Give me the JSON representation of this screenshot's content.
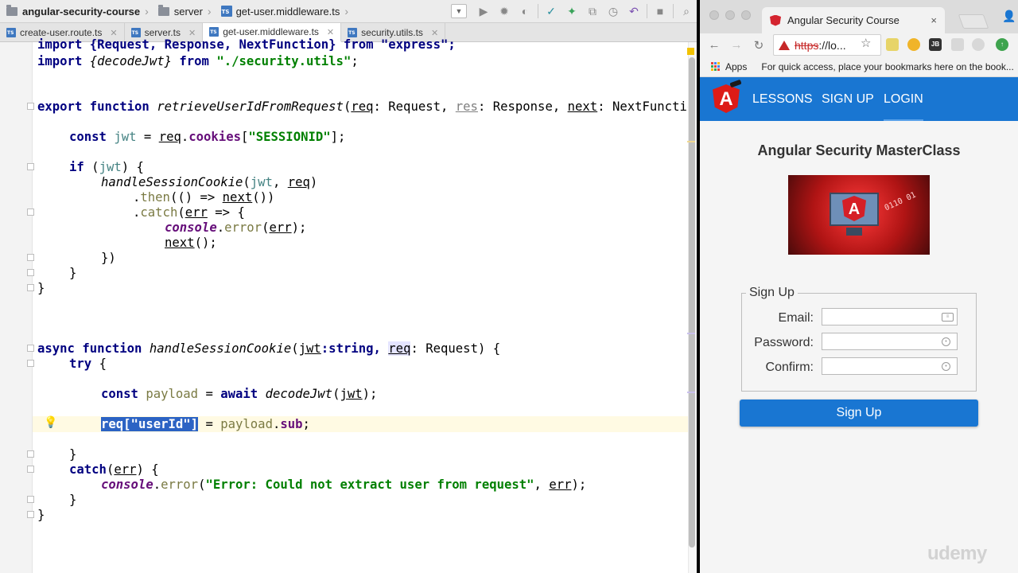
{
  "ide": {
    "breadcrumb": [
      {
        "label": "angular-security-course",
        "icon": "folder-icon"
      },
      {
        "label": "server",
        "icon": "folder-icon"
      },
      {
        "label": "get-user.middleware.ts",
        "icon": "typescript-file-icon"
      }
    ],
    "tabs": [
      {
        "label": "create-user.route.ts",
        "active": false
      },
      {
        "label": "server.ts",
        "active": false
      },
      {
        "label": "get-user.middleware.ts",
        "active": true
      },
      {
        "label": "security.utils.ts",
        "active": false
      }
    ],
    "file_icon_text": "TS"
  },
  "code": {
    "lines": {
      "l1": "import {Request, Response, NextFunction} from \"express\";",
      "l2a": "import ",
      "l2b": "{decodeJwt}",
      "l2c": " from ",
      "l2d": "\"./security.utils\"",
      "l2e": ";",
      "l5a": "export ",
      "l5b": "function ",
      "l5c": "retrieveUserIdFromRequest",
      "l5d": "(",
      "l5e": "req",
      "l5f": ": Request, ",
      "l5g": "res",
      "l5h": ": Response, ",
      "l5i": "next",
      "l5j": ": NextFunction) {",
      "l7a": "const ",
      "l7b": "jwt",
      "l7c": " = ",
      "l7d": "req",
      "l7e": ".",
      "l7f": "cookies",
      "l7g": "[",
      "l7h": "\"SESSIONID\"",
      "l7i": "];",
      "l9a": "if ",
      "l9b": "(",
      "l9c": "jwt",
      "l9d": ") {",
      "l10a": "handleSessionCookie",
      "l10b": "(",
      "l10c": "jwt",
      "l10d": ", ",
      "l10e": "req",
      "l10f": ")",
      "l11a": ".",
      "l11b": "then",
      "l11c": "(() => ",
      "l11d": "next",
      "l11e": "())",
      "l12a": ".",
      "l12b": "catch",
      "l12c": "(",
      "l12d": "err",
      "l12e": " => {",
      "l13a": "console",
      "l13b": ".",
      "l13c": "error",
      "l13d": "(",
      "l13e": "err",
      "l13f": ");",
      "l14a": "next",
      "l14b": "();",
      "l15": "})",
      "l16": "}",
      "l17": "}",
      "l21a": "async ",
      "l21b": "function ",
      "l21c": "handleSessionCookie",
      "l21d": "(",
      "l21e": "jwt",
      "l21f": ":string, ",
      "l21g": "req",
      "l21h": ": Request) {",
      "l22a": "try ",
      "l22b": "{",
      "l24a": "const ",
      "l24b": "payload",
      "l24c": " = ",
      "l24d": "await ",
      "l24e": "decodeJwt",
      "l24f": "(",
      "l24g": "jwt",
      "l24h": ");",
      "l26a": "req[\"userId\"]",
      "l26b": " = ",
      "l26c": "payload",
      "l26d": ".",
      "l26e": "sub",
      "l26f": ";",
      "l28": "}",
      "l29a": "catch",
      "l29b": "(",
      "l29c": "err",
      "l29d": ") {",
      "l30a": "console",
      "l30b": ".",
      "l30c": "error",
      "l30d": "(",
      "l30e": "\"Error: Could not extract user from request\"",
      "l30f": ", ",
      "l30g": "err",
      "l30h": ");",
      "l31": "}",
      "l32": "}"
    }
  },
  "browser": {
    "tab_title": "Angular Security Course",
    "tab_close": "×",
    "url_scheme": "https",
    "url_rest": "://lo...",
    "bookmarks_apps": "Apps",
    "bookmarks_hint": "For quick access, place your bookmarks here on the book...",
    "ext_labels": {
      "jb": "JB"
    }
  },
  "app": {
    "logo_letter": "A",
    "nav": [
      {
        "label": "LESSONS",
        "active": false
      },
      {
        "label": "SIGN UP",
        "active": false
      },
      {
        "label": "LOGIN",
        "active": true
      }
    ],
    "title": "Angular Security MasterClass",
    "hero_bits": "0110 01",
    "form": {
      "legend": "Sign Up",
      "email_label": "Email:",
      "password_label": "Password:",
      "confirm_label": "Confirm:",
      "email_value": "",
      "password_value": "",
      "confirm_value": "",
      "submit_label": "Sign Up"
    }
  },
  "watermark": "udemy",
  "colors": {
    "accent": "#1976d2",
    "angular_red": "#dd1b16",
    "selection": "#2c63c4"
  }
}
